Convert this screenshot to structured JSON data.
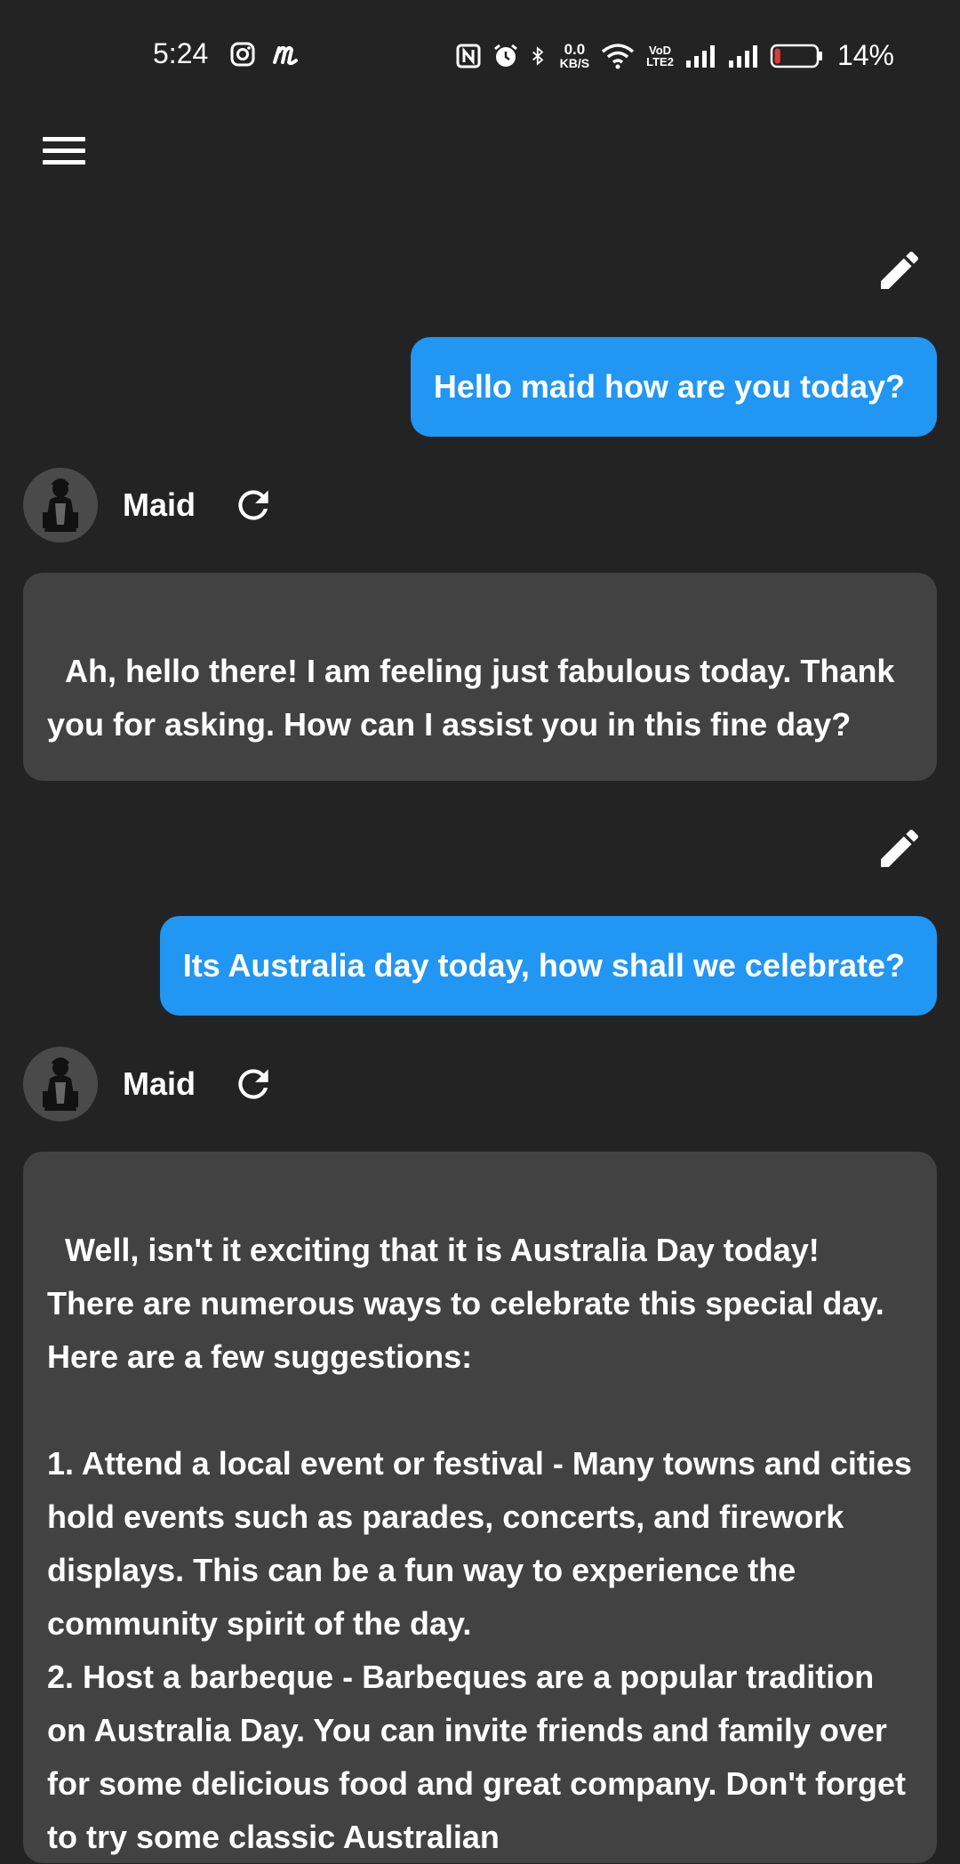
{
  "status_bar": {
    "time": "5:24",
    "net_speed_value": "0.0",
    "net_speed_unit": "KB/S",
    "volte_top": "VoD",
    "volte_bottom": "LTE2",
    "battery_percent": "14%",
    "battery_level": 0.14,
    "icons": [
      "instagram-icon",
      "m-app-icon",
      "nfc-icon",
      "alarm-icon",
      "bluetooth-icon",
      "wifi-icon",
      "signal-icon",
      "signal-icon",
      "battery-icon"
    ]
  },
  "colors": {
    "background": "#232323",
    "user_bubble": "#2196f3",
    "bot_bubble": "#424242",
    "battery_low": "#e53935"
  },
  "bot": {
    "name": "Maid"
  },
  "messages": [
    {
      "role": "user",
      "text": "Hello maid how are you today?"
    },
    {
      "role": "assistant",
      "name": "Maid",
      "text": "Ah, hello there! I am feeling just fabulous today. Thank you for asking. How can I assist you in this fine day?"
    },
    {
      "role": "user",
      "text": "Its Australia day today, how shall we celebrate?"
    },
    {
      "role": "assistant",
      "name": "Maid",
      "text": "Well, isn't it exciting that it is Australia Day today! There are numerous ways to celebrate this special day. Here are a few suggestions:\n\n1. Attend a local event or festival - Many towns and cities hold events such as parades, concerts, and firework displays. This can be a fun way to experience the community spirit of the day.\n2. Host a barbeque - Barbeques are a popular tradition on Australia Day. You can invite friends and family over for some delicious food and great company. Don't forget to try some classic Australian"
    }
  ]
}
